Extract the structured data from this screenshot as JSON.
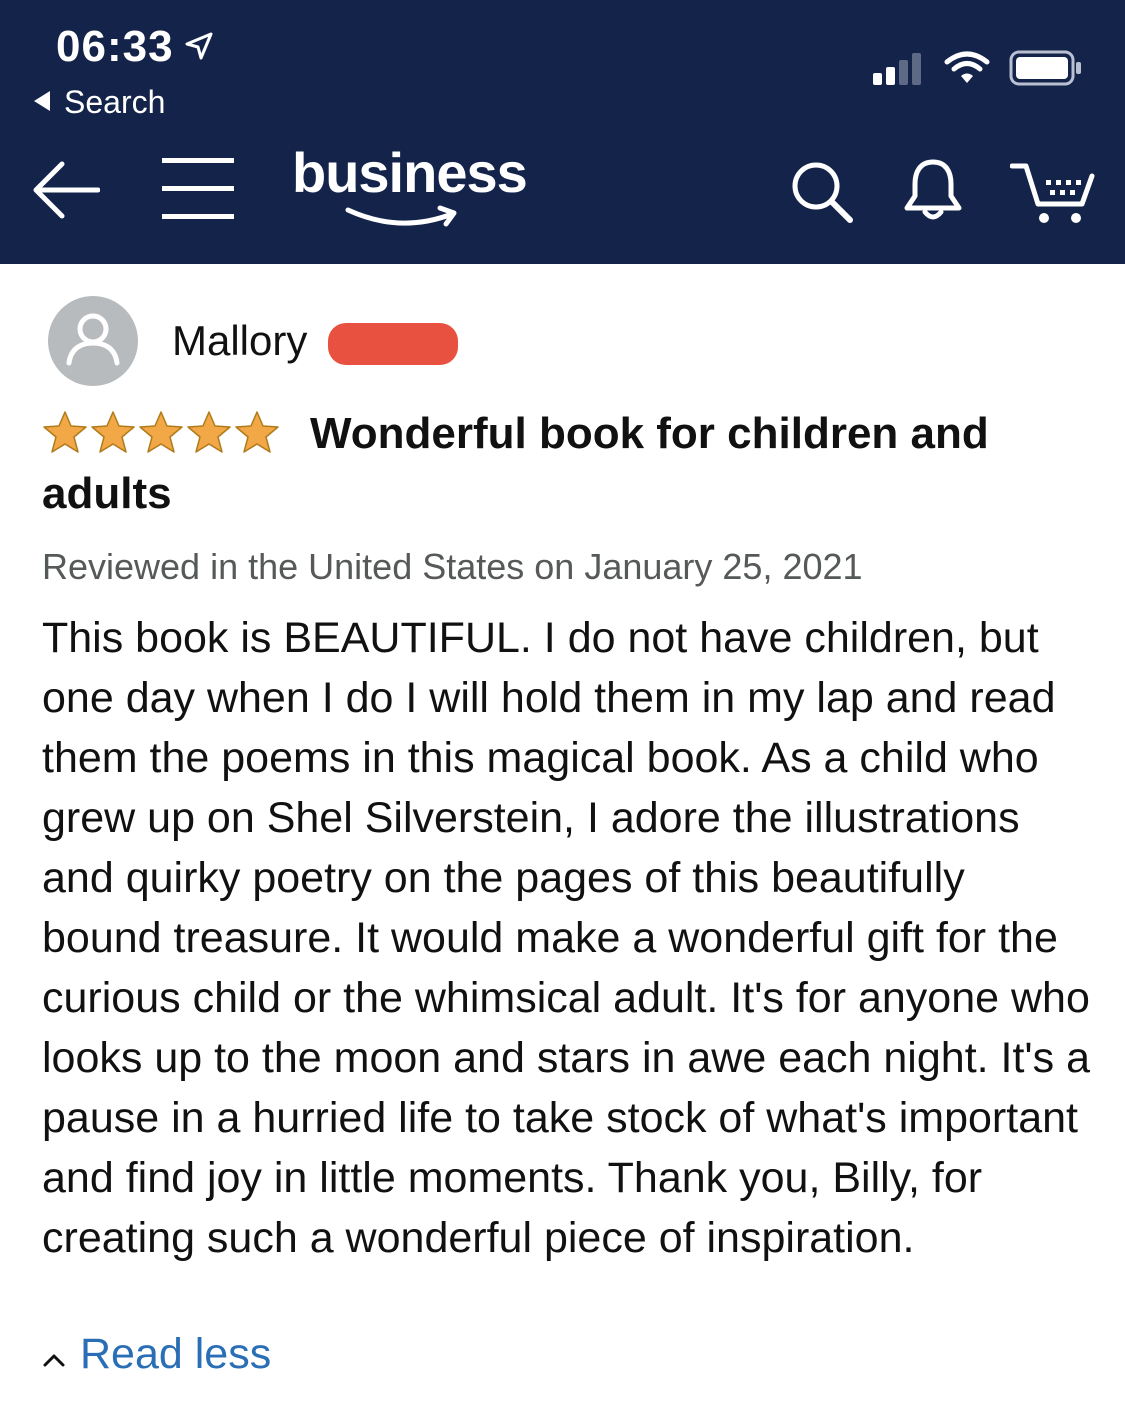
{
  "status": {
    "time": "06:33",
    "back_app_label": "Search"
  },
  "nav": {
    "logo_text": "business",
    "icons": [
      "back-arrow-icon",
      "menu-icon",
      "search-icon",
      "bell-icon",
      "cart-icon"
    ]
  },
  "review": {
    "reviewer_name": "Mallory",
    "rating": 5,
    "rating_max": 5,
    "title": "Wonderful book for children and adults",
    "date": "Reviewed in the United States on January 25, 2021",
    "body": "This book is BEAUTIFUL. I do not have children, but one day when I do I will hold them in my lap and read them the poems in this magical book. As a child who grew up on Shel Silverstein, I adore the illustrations and quirky poetry on the pages of this beautifully bound treasure. It would make a wonderful gift for the curious child or the whimsical adult. It's for anyone who looks up to the moon and stars in awe each night. It's a pause in a hurried life to take stock of what's important and find joy in little moments. Thank you, Billy, for creating such a wonderful piece of inspiration.",
    "read_less_label": "Read less"
  },
  "colors": {
    "header_bg": "#13234a",
    "star": "#f3a847",
    "link": "#2a6fb6",
    "redaction": "#e8503f"
  }
}
